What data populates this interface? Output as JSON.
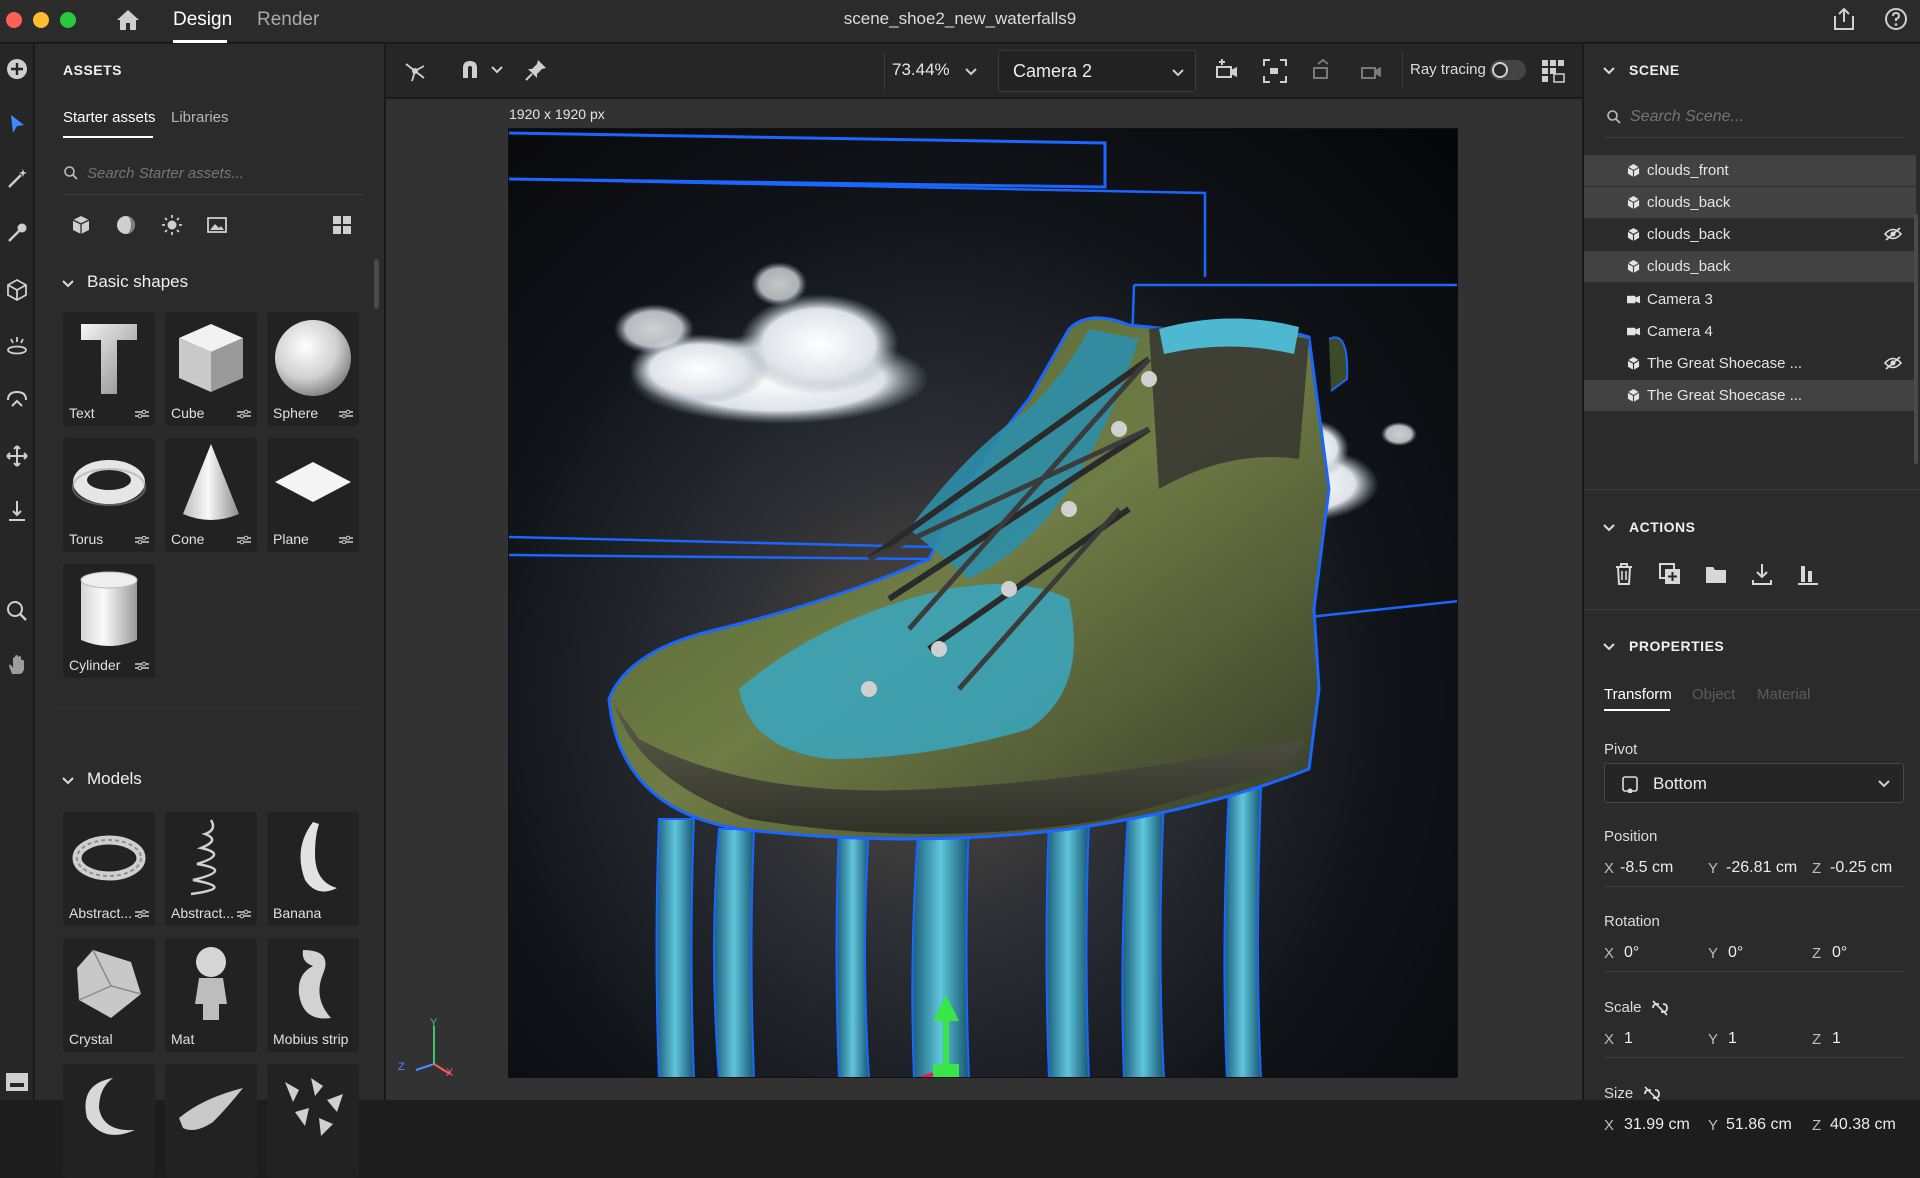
{
  "titlebar": {
    "tabs": [
      {
        "label": "Design"
      },
      {
        "label": "Render"
      }
    ],
    "document_title": "scene_shoe2_new_waterfalls9"
  },
  "assets": {
    "header": "ASSETS",
    "subtabs": [
      {
        "label": "Starter assets"
      },
      {
        "label": "Libraries"
      }
    ],
    "search_placeholder": "Search Starter assets...",
    "basic_shapes": {
      "title": "Basic shapes",
      "items": [
        {
          "label": "Text"
        },
        {
          "label": "Cube"
        },
        {
          "label": "Sphere"
        },
        {
          "label": "Torus"
        },
        {
          "label": "Cone"
        },
        {
          "label": "Plane"
        },
        {
          "label": "Cylinder"
        }
      ]
    },
    "models": {
      "title": "Models",
      "items": [
        {
          "label": "Abstract..."
        },
        {
          "label": "Abstract..."
        },
        {
          "label": "Banana"
        },
        {
          "label": "Crystal"
        },
        {
          "label": "Mat"
        },
        {
          "label": "Mobius strip"
        },
        {
          "label": ""
        },
        {
          "label": ""
        },
        {
          "label": ""
        }
      ]
    }
  },
  "canvas": {
    "zoom": "73.44%",
    "camera": "Camera 2",
    "ray_tracing_label": "Ray tracing",
    "ray_tracing_on": false,
    "artboard_size": "1920 x 1920 px",
    "gizmo_axes": {
      "x": "X",
      "y": "Y",
      "z": "Z"
    }
  },
  "scene": {
    "header": "SCENE",
    "search_placeholder": "Search Scene...",
    "items": [
      {
        "name": "clouds_front",
        "type": "object",
        "selected": true,
        "hidden": false
      },
      {
        "name": "clouds_back",
        "type": "object",
        "selected": true,
        "hidden": false
      },
      {
        "name": "clouds_back",
        "type": "object",
        "selected": false,
        "hidden": true
      },
      {
        "name": "clouds_back",
        "type": "object",
        "selected": true,
        "hidden": false
      },
      {
        "name": "Camera 3",
        "type": "camera",
        "selected": false,
        "hidden": false
      },
      {
        "name": "Camera 4",
        "type": "camera",
        "selected": false,
        "hidden": false
      },
      {
        "name": "The Great Shoecase ...",
        "type": "object",
        "selected": false,
        "hidden": true
      },
      {
        "name": "The Great Shoecase ...",
        "type": "object",
        "selected": true,
        "hidden": false
      }
    ]
  },
  "actions": {
    "header": "ACTIONS"
  },
  "properties": {
    "header": "PROPERTIES",
    "tabs": [
      {
        "label": "Transform"
      },
      {
        "label": "Object"
      },
      {
        "label": "Material"
      }
    ],
    "pivot": {
      "label": "Pivot",
      "value": "Bottom"
    },
    "position": {
      "label": "Position",
      "x": "-8.5 cm",
      "y": "-26.81 cm",
      "z": "-0.25 cm"
    },
    "rotation": {
      "label": "Rotation",
      "x": "0°",
      "y": "0°",
      "z": "0°"
    },
    "scale": {
      "label": "Scale",
      "x": "1",
      "y": "1",
      "z": "1"
    },
    "size": {
      "label": "Size",
      "x": "31.99 cm",
      "y": "51.86 cm",
      "z": "40.38 cm"
    },
    "axis_labels": {
      "x": "X",
      "y": "Y",
      "z": "Z"
    }
  },
  "colors": {
    "accent": "#2a73e8",
    "selection_outline": "#1a66ff",
    "gizmo_green": "#39e64a",
    "panel_bg": "#2b2b2b"
  }
}
